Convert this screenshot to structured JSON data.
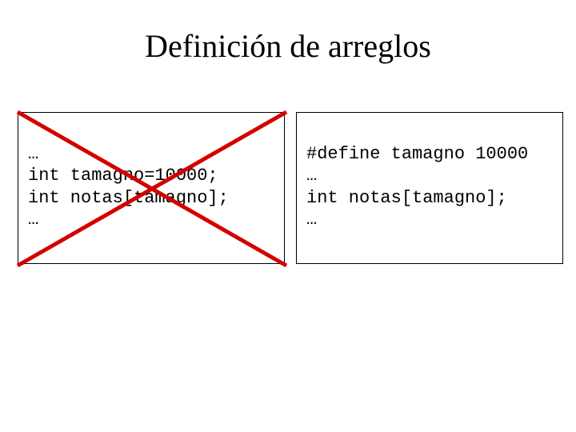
{
  "title": "Definición de arreglos",
  "left_box": {
    "line1": "…",
    "line2": "int tamagno=10000;",
    "line3": "int notas[tamagno];",
    "line4": "…"
  },
  "right_box": {
    "line1": "#define tamagno 10000",
    "line2": "…",
    "line3": "int notas[tamagno];",
    "line4": "…"
  },
  "cross_color": "#d40000"
}
